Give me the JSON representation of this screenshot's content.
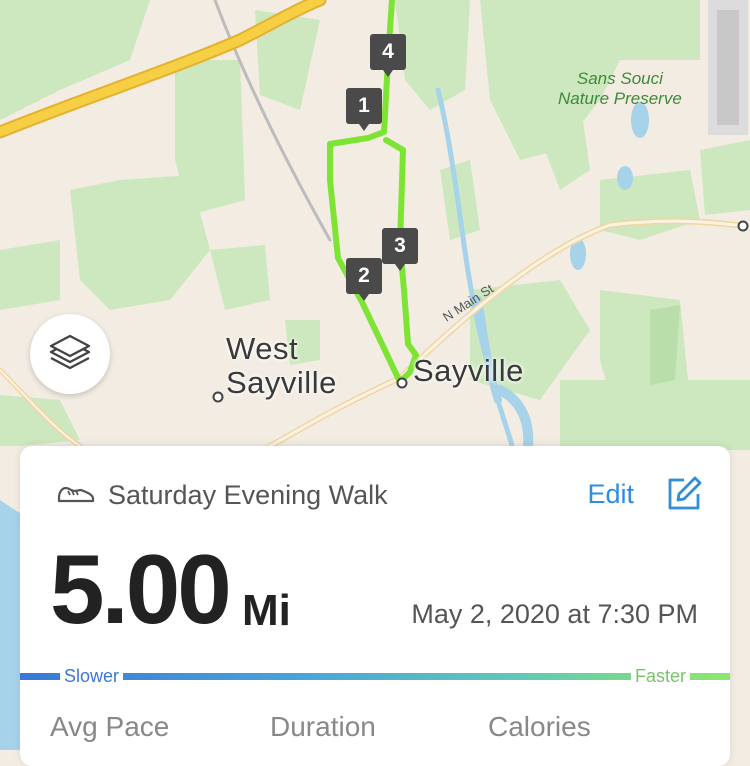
{
  "map": {
    "towns": {
      "west_sayville": "West\nSayville",
      "sayville": "Sayville"
    },
    "preserve": "Sans Souci\nNature Preserve",
    "street": "N Main St",
    "markers": [
      "1",
      "2",
      "3",
      "4"
    ],
    "colors": {
      "route": "#7de434",
      "land": "#f2ece2",
      "park": "#c9e6bb",
      "water": "#a7d3ea",
      "highway": "#f6cb3c"
    }
  },
  "layers_button": {
    "icon": "layers-icon"
  },
  "activity": {
    "icon": "shoe-icon",
    "title": "Saturday Evening Walk",
    "edit_label": "Edit",
    "edit_icon": "edit-icon",
    "distance": "5.00",
    "unit": "Mi",
    "date": "May 2, 2020 at 7:30 PM",
    "pace_slower": "Slower",
    "pace_faster": "Faster",
    "stats": [
      "Avg Pace",
      "Duration",
      "Calories"
    ]
  }
}
